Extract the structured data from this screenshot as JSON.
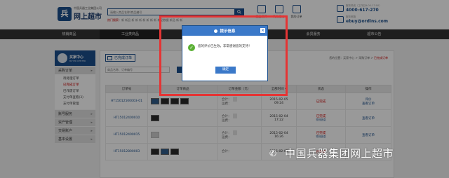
{
  "header": {
    "logo_subtitle": "中国兵器工业集团公司",
    "logo_title": "网上超市",
    "search_placeholder": "请输入商品名称/商品编号",
    "hot_label": "热门搜索：",
    "hot_words": "新 新品 新 新 新 新 新 新 新 新品数据 新品 新 新",
    "quick_links": [
      "正品保障",
      "购物指南",
      "我的订单"
    ],
    "hotline_label": "服务热线（工作日9:00-17:00）",
    "hotline": "4000-617-270",
    "email_label": "服务邮箱",
    "email": "ebuy@ordins.com"
  },
  "nav": {
    "items": [
      "热销商品",
      "工业类商品",
      "",
      "",
      "会员服务",
      "超市公告"
    ]
  },
  "sidebar": {
    "title": "买家中心",
    "subtitle": "BUYER CENTER",
    "groups": [
      {
        "label": "采购订单",
        "items": [
          "待处理订单",
          "已完成订单",
          "已作废订单",
          "支付单查看(3)",
          "支付单管理"
        ]
      },
      {
        "label": "账号服务",
        "items": []
      },
      {
        "label": "资产管理",
        "items": []
      },
      {
        "label": "交易账户",
        "items": []
      },
      {
        "label": "基本设置",
        "items": []
      }
    ]
  },
  "content": {
    "title": "已完成订单",
    "breadcrumb_prefix": "您的位置：买家中心 > 采购订单 >",
    "breadcrumb_current": "已完成订单",
    "filter_placeholder": "商品名称、订单编号",
    "table": {
      "headers": [
        "订单号",
        "订单商品",
        "订单金额（元）",
        "全部时间",
        "状态",
        "操作"
      ],
      "rows": [
        {
          "order_no": "HT15012500003-01",
          "amount": [
            "合计：",
            "运费："
          ],
          "date": "2015-02-05",
          "time": "09:24",
          "status": "已完成",
          "status_sub": "",
          "ops": [
            "评价",
            "查看订单"
          ]
        },
        {
          "order_no": "HT15012400010",
          "amount": [
            "合计：",
            "运费："
          ],
          "date": "2015-02-04",
          "time": "17:22",
          "status": "已完成",
          "status_sub": "物流信息",
          "ops": [
            "查看订单",
            ""
          ]
        },
        {
          "order_no": "HT15012400015",
          "amount": [
            "合计：",
            "运费："
          ],
          "date": "2015-02-04",
          "time": "16:26",
          "status": "已完成",
          "status_sub": "物流信息",
          "ops": [
            "查看订单",
            ""
          ]
        },
        {
          "order_no": "HT15012800003",
          "amount": [
            "合计：",
            ""
          ],
          "date": "2015-02-02",
          "time": "",
          "status": "已完成",
          "status_sub": "",
          "ops": [
            "",
            ""
          ]
        }
      ]
    }
  },
  "dialog": {
    "title": "提示信息",
    "message": "您的评价已生效，非常感谢您的支持！",
    "ok_label": "确定"
  },
  "watermark": {
    "text": "中国兵器集团网上超市"
  },
  "colors": {
    "brand": "#1b4f8c",
    "nav": "#333333",
    "dialog_header": "#3b79c9",
    "highlight_box": "#e53434",
    "success": "#5ab033",
    "status": "#cc0000"
  }
}
